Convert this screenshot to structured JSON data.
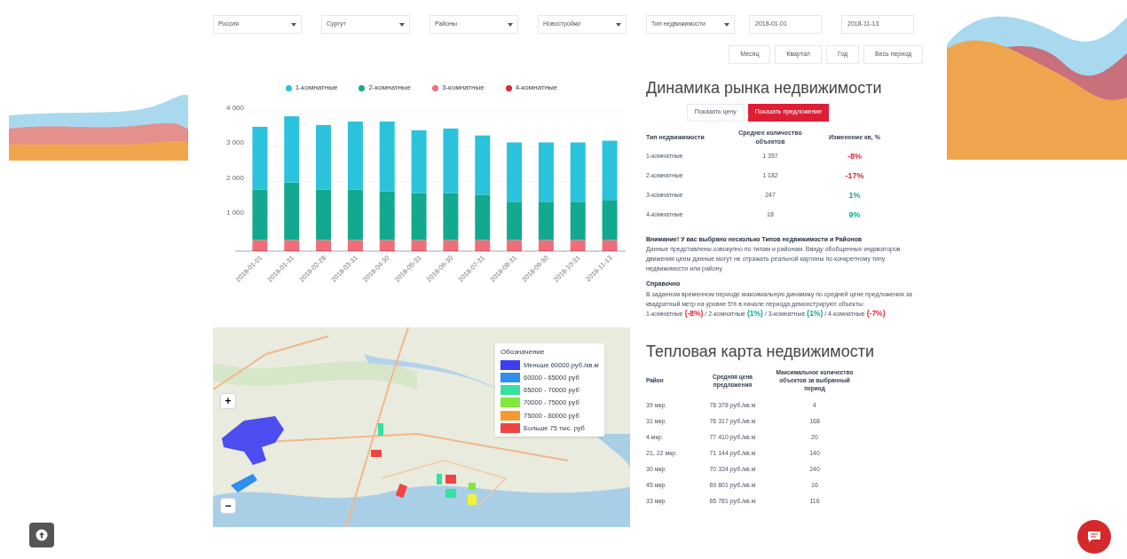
{
  "filters": {
    "selects": [
      "Россия",
      "Сургут",
      "Районы",
      "Новостройки",
      "Тип недвижимости"
    ],
    "dates": [
      "2018-01-01",
      "2018-11-13"
    ]
  },
  "periods": [
    {
      "label": "Месяц"
    },
    {
      "label": "Квартал"
    },
    {
      "label": "Год"
    },
    {
      "label": "Весь период"
    }
  ],
  "market_chart": {
    "chart_data": {
      "type": "bar",
      "stacked": true,
      "grid": true,
      "legend": "top",
      "categories": [
        "2018-01-01",
        "2018-01-31",
        "2018-02-28",
        "2018-03-31",
        "2018-04-30",
        "2018-05-31",
        "2018-06-30",
        "2018-07-31",
        "2018-08-31",
        "2018-09-30",
        "2018-10-31",
        "2018-11-13"
      ],
      "ylim": [
        0,
        4000
      ],
      "yticks": [
        {
          "value": 1000,
          "label": "1 000"
        },
        {
          "value": 2000,
          "label": "2 000"
        },
        {
          "value": 3000,
          "label": "3 000"
        },
        {
          "value": 4000,
          "label": "4 000"
        }
      ],
      "series": [
        {
          "name": "1-комнатные",
          "color": "#2ac3db",
          "values": [
            1800,
            1900,
            1850,
            1950,
            2000,
            1800,
            1850,
            1700,
            1700,
            1700,
            1700,
            1700
          ]
        },
        {
          "name": "2-комнатные",
          "color": "#13a98f",
          "values": [
            1450,
            1650,
            1450,
            1450,
            1400,
            1350,
            1350,
            1300,
            1100,
            1100,
            1100,
            1150
          ]
        },
        {
          "name": "3-комнатные",
          "color": "#ee6f7b",
          "values": [
            300,
            300,
            300,
            300,
            300,
            300,
            300,
            300,
            300,
            300,
            300,
            300
          ]
        },
        {
          "name": "4-комнатные",
          "color": "#e0263b",
          "values": [
            20,
            20,
            20,
            20,
            20,
            20,
            20,
            20,
            20,
            20,
            20,
            20
          ]
        }
      ]
    }
  },
  "market": {
    "title": "Динамика рынка недвижимости",
    "toggle": [
      {
        "label": "Показать цену",
        "selected": false
      },
      {
        "label": "Показать предложение",
        "selected": true
      }
    ],
    "columns": [
      "Тип недвижимости",
      "Среднее количество объектов",
      "Изменение кв, %"
    ],
    "rows": [
      {
        "type": "1-комнатные",
        "count": "1 357",
        "change": "-8%",
        "color": "#e0263b"
      },
      {
        "type": "2-комнатные",
        "count": "1 182",
        "change": "-17%",
        "color": "#e0263b"
      },
      {
        "type": "3-комнатные",
        "count": "247",
        "change": "1%",
        "color": "#13a98f"
      },
      {
        "type": "4-комнатные",
        "count": "18",
        "change": "9%",
        "color": "#13a98f"
      }
    ],
    "warning": {
      "title": "Внимание! У вас выбрано несколько Типов недвижимости и Районов",
      "text": "Данные представлены совокупно по типам и районам. Ввиду обобщенных индикаторов движения цены данные могут не отражать реальной картины по конкретному типу недвижимости или району"
    },
    "reference": {
      "title": "Справочно",
      "text": "В заданном временном периоде максимальную динамику по средней цене предложения за квадратный метр на уровне 5% в начале периода демонстрируют объекты:",
      "items": [
        {
          "label": "1-комнатные",
          "value": "(-8%)",
          "color": "#e0263b"
        },
        {
          "label": "/ 2-комнатные",
          "value": "(1%)",
          "color": "#13a98f"
        },
        {
          "label": "/ 3-комнатные",
          "value": "(1%)",
          "color": "#13a98f"
        },
        {
          "label": "/ 4-комнатные",
          "value": "(-7%)",
          "color": "#e0263b"
        }
      ]
    }
  },
  "map": {
    "legend_title": "Обозначение",
    "legend": [
      {
        "label": "Меньше 60000 руб./кв.м",
        "color": "#3c3cf2"
      },
      {
        "label": "60000 - 65000 руб",
        "color": "#2f8ef0"
      },
      {
        "label": "65000 - 70000 руб",
        "color": "#35e0a0"
      },
      {
        "label": "70000 - 75000 руб",
        "color": "#7fe83a"
      },
      {
        "label": "75000 - 80000 руб",
        "color": "#f59a30"
      },
      {
        "label": "Больше 75 тыс. руб",
        "color": "#f04444"
      }
    ],
    "zoom_in": "+",
    "zoom_out": "−"
  },
  "heat": {
    "title": "Тепловая карта недвижимости",
    "columns": [
      "Район",
      "Средняя цена предложения",
      "Максимальное количество объектов за выбранный период"
    ],
    "rows": [
      [
        "39 мкр.",
        "78 378 руб./кв.м",
        "4"
      ],
      [
        "31 мкр.",
        "76 317 руб./кв.м",
        "168"
      ],
      [
        "4 мкр.",
        "77 410 руб./кв.м",
        "20"
      ],
      [
        "21, 22 мкр.",
        "71 144 руб./кв.м",
        "140"
      ],
      [
        "30 мкр.",
        "70 334 руб./кв.м",
        "240"
      ],
      [
        "45 мкр.",
        "69 801 руб./кв.м",
        "16"
      ],
      [
        "33 мкр.",
        "65 781 руб./кв.м",
        "116"
      ]
    ]
  }
}
